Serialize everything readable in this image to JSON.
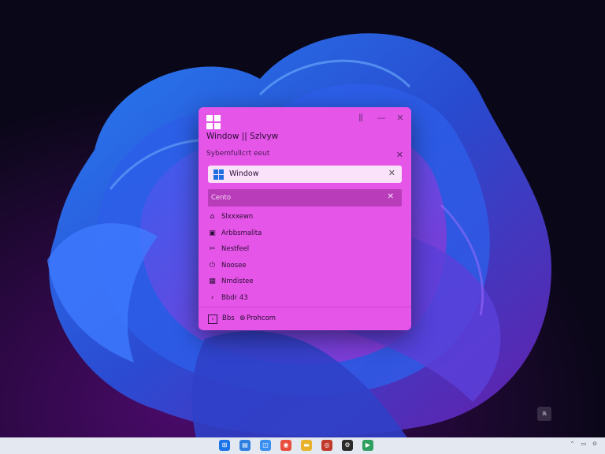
{
  "panel": {
    "title": "Window || Szlvyw",
    "section_header": "Sybemfullcrt eeut",
    "search_value": "Window",
    "selected_item": "Cento",
    "items": [
      {
        "icon": "home-icon",
        "glyph": "⌂",
        "label": "Slxxxewn"
      },
      {
        "icon": "app-icon",
        "glyph": "▣",
        "label": "Arbbsmalita"
      },
      {
        "icon": "tools-icon",
        "glyph": "✂",
        "label": "Nestfeel"
      },
      {
        "icon": "power-icon",
        "glyph": "⏻",
        "label": "Noosee"
      },
      {
        "icon": "keyboard-icon",
        "glyph": "▦",
        "label": "Nmdistee"
      },
      {
        "icon": "terminal-icon",
        "glyph": "›",
        "label": "Bbdr 43"
      }
    ],
    "footer": {
      "left_label": "Bbs",
      "right_label": "Prohcom"
    },
    "controls": {
      "pin": "⫼",
      "minimize": "—",
      "close": "✕"
    }
  },
  "desktop": {
    "corner_icon_label": "ℝ"
  },
  "taskbar": {
    "icons": [
      {
        "name": "start-icon",
        "color": "#1a73e8"
      },
      {
        "name": "file-explorer-icon",
        "color": "#2d7fe0"
      },
      {
        "name": "store-icon",
        "color": "#3a8ef0"
      },
      {
        "name": "chrome-icon",
        "color": "#e94e3c"
      },
      {
        "name": "folder-icon",
        "color": "#e8b22c"
      },
      {
        "name": "app-icon",
        "color": "#c0392b"
      },
      {
        "name": "settings-icon",
        "color": "#2b2b2b"
      },
      {
        "name": "media-icon",
        "color": "#30a060"
      }
    ],
    "tray": {
      "chevron": "⌃",
      "network": "▭",
      "clock": "⊙"
    }
  },
  "colors": {
    "panel_bg": "#e455e8",
    "selected_row": "#b93dba",
    "taskbar_bg": "#e4e8f1"
  }
}
